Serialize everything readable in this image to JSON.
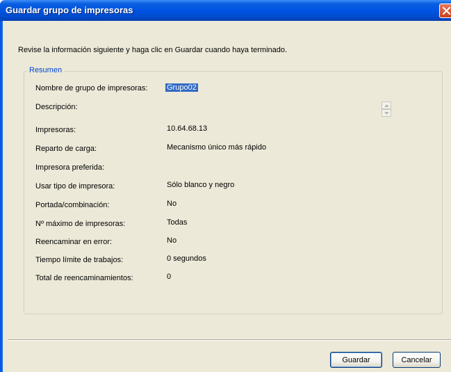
{
  "window": {
    "title": "Guardar grupo de impresoras",
    "close_icon": "close-icon"
  },
  "instruction": "Revise la información siguiente y haga clic en Guardar cuando haya terminado.",
  "summary": {
    "legend": "Resumen",
    "rows": [
      {
        "label": "Nombre de grupo de impresoras:",
        "value": "Grupo02"
      },
      {
        "label": "Descripción:",
        "value": ""
      },
      {
        "label": "Impresoras:",
        "value": "10.64.68.13"
      },
      {
        "label": "Reparto de carga:",
        "value": "Mecanismo único más rápido"
      },
      {
        "label": "Impresora preferida:",
        "value": ""
      },
      {
        "label": "Usar tipo de impresora:",
        "value": "Sólo blanco y negro"
      },
      {
        "label": "Portada/combinación:",
        "value": "No"
      },
      {
        "label": "Nº máximo de impresoras:",
        "value": "Todas"
      },
      {
        "label": "Reencaminar en error:",
        "value": "No"
      },
      {
        "label": "Tiempo límite de trabajos:",
        "value": "0 segundos"
      },
      {
        "label": "Total de reencaminamientos:",
        "value": "0"
      }
    ]
  },
  "buttons": {
    "save": "Guardar",
    "cancel": "Cancelar"
  },
  "colors": {
    "titlebar": "#0054e3",
    "client_background": "#ece9d8",
    "legend_text": "#0046d5",
    "selection": "#316ac5",
    "close_button": "#d6542f"
  }
}
